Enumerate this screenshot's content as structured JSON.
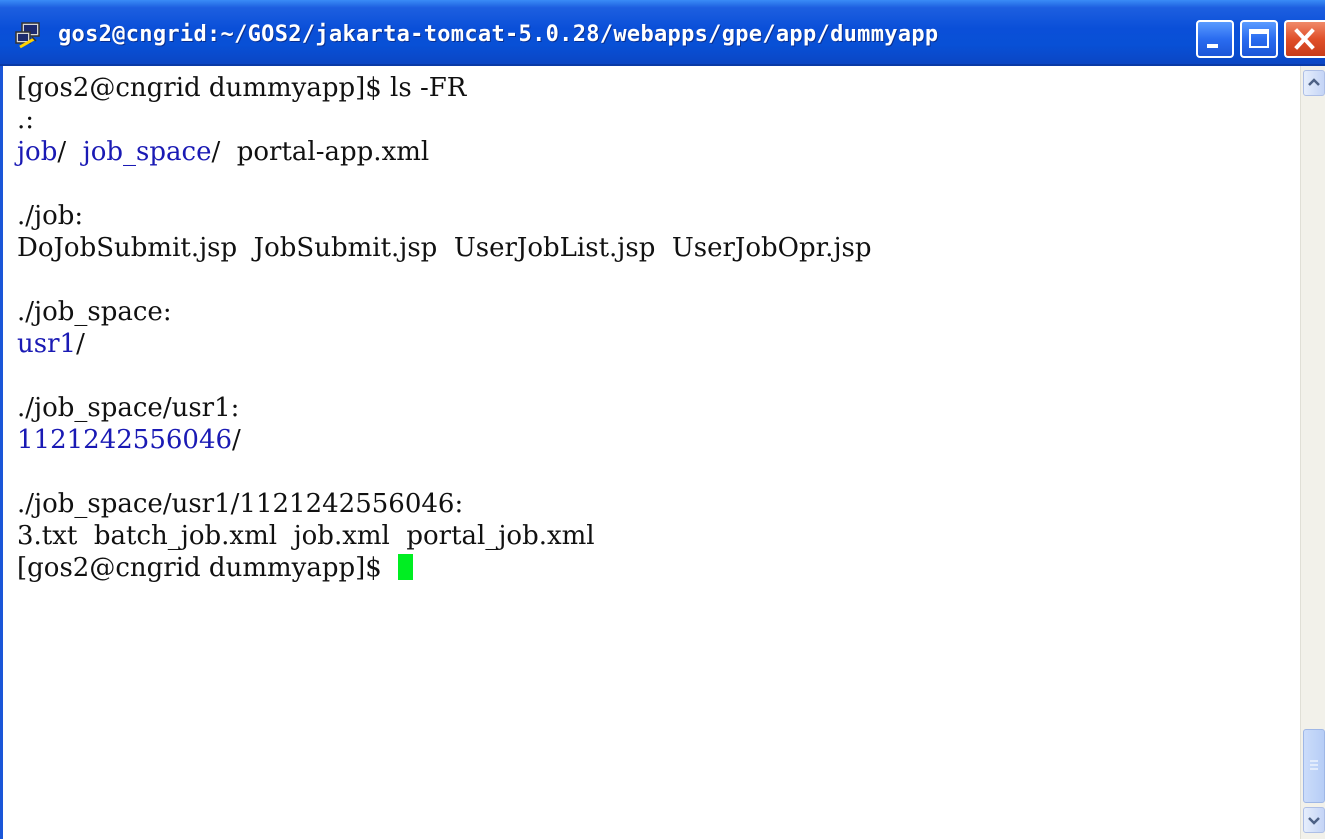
{
  "window": {
    "title": "gos2@cngrid:~/GOS2/jakarta-tomcat-5.0.28/webapps/gpe/app/dummyapp",
    "app_icon": "putty-icon",
    "controls": [
      "minimize-icon",
      "maximize-icon",
      "close-icon"
    ]
  },
  "colors": {
    "titlebar": "#0a4fd8",
    "directory_text": "#1a1ab4",
    "cursor": "#00ee22",
    "close_button": "#e0502a"
  },
  "terminal": {
    "lines": [
      {
        "text": "[gos2@cngrid dummyapp]$ ls -FR"
      },
      {
        "text": ".:"
      },
      {
        "segments": [
          {
            "text": "job",
            "type": "dir"
          },
          {
            "text": "/  ",
            "type": "plain"
          },
          {
            "text": "job_space",
            "type": "dir"
          },
          {
            "text": "/  portal-app.xml",
            "type": "plain"
          }
        ]
      },
      {
        "text": ""
      },
      {
        "text": "./job:"
      },
      {
        "text": "DoJobSubmit.jsp  JobSubmit.jsp  UserJobList.jsp  UserJobOpr.jsp"
      },
      {
        "text": ""
      },
      {
        "text": "./job_space:"
      },
      {
        "segments": [
          {
            "text": "usr1",
            "type": "dir"
          },
          {
            "text": "/",
            "type": "plain"
          }
        ]
      },
      {
        "text": ""
      },
      {
        "text": "./job_space/usr1:"
      },
      {
        "segments": [
          {
            "text": "1121242556046",
            "type": "dir"
          },
          {
            "text": "/",
            "type": "plain"
          }
        ]
      },
      {
        "text": ""
      },
      {
        "text": "./job_space/usr1/1121242556046:"
      },
      {
        "text": "3.txt  batch_job.xml  job.xml  portal_job.xml"
      },
      {
        "text": "[gos2@cngrid dummyapp]$ ",
        "cursor": true
      }
    ]
  },
  "scrollbar": {
    "up_icon": "arrow-up-icon",
    "down_icon": "arrow-down-icon"
  }
}
